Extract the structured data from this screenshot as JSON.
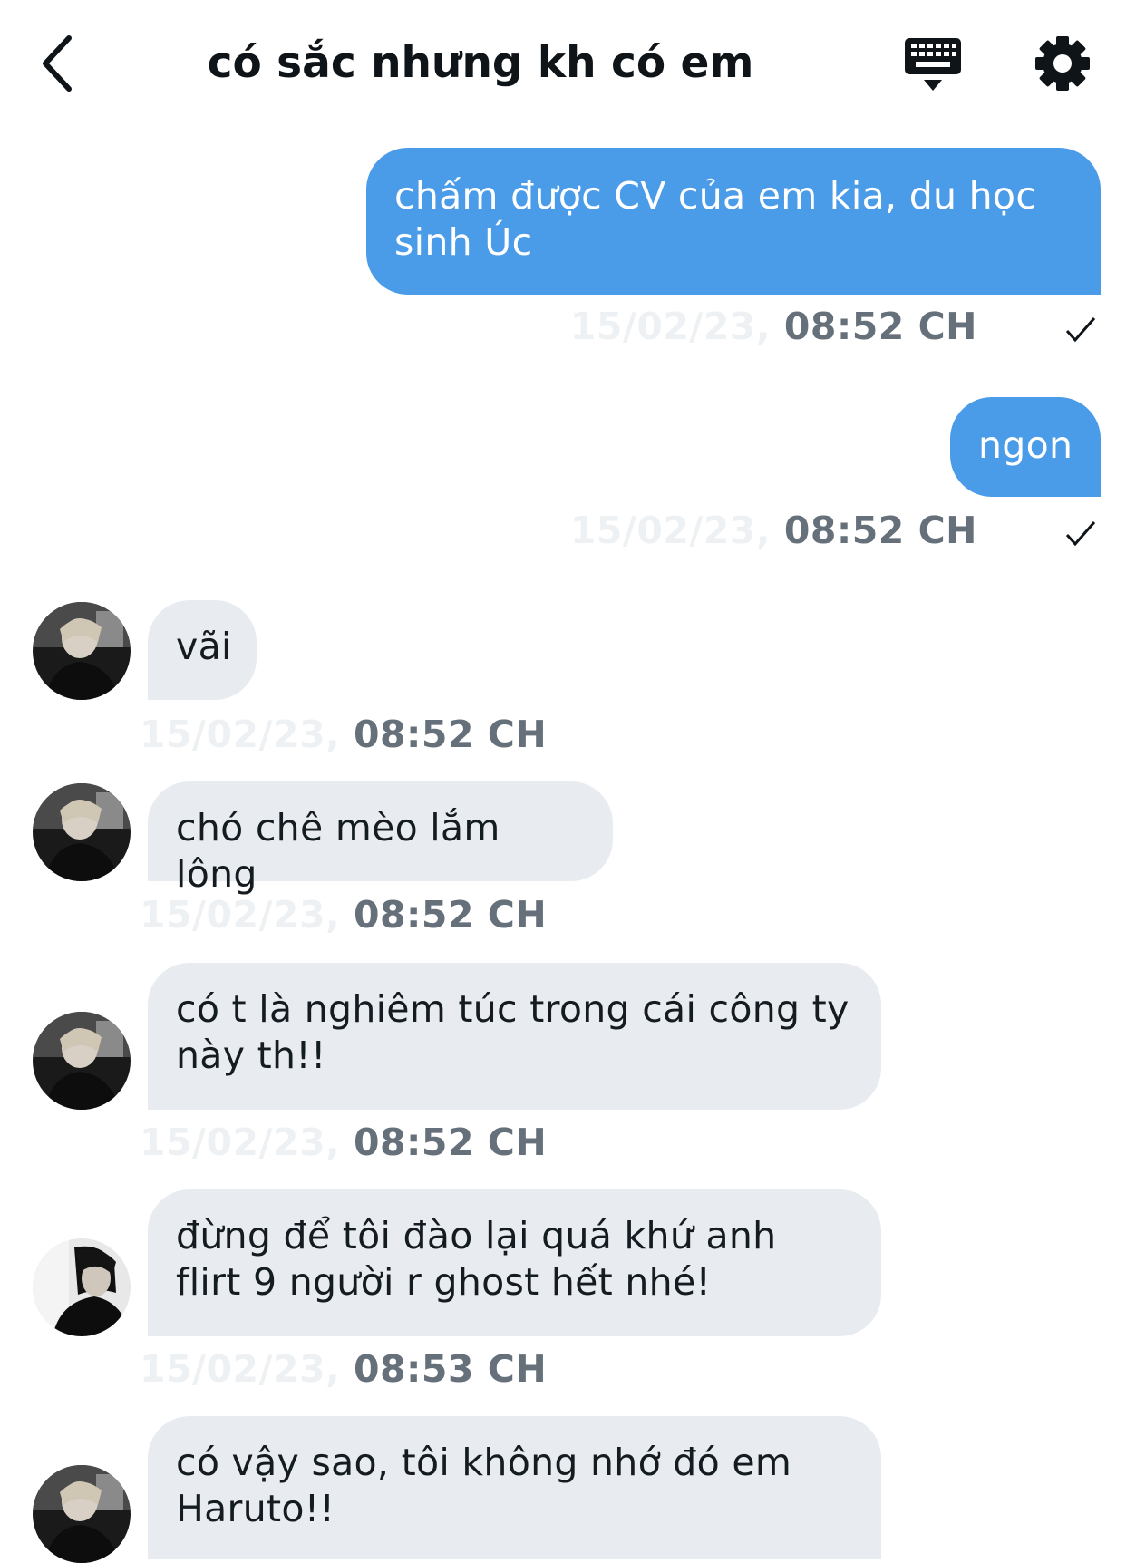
{
  "header": {
    "title": "có sắc nhưng kh có em",
    "back_icon": "chevron-left-icon",
    "keyboard_icon": "keyboard-icon",
    "settings_icon": "gear-icon"
  },
  "colors": {
    "outgoing_bubble": "#4a9be8",
    "incoming_bubble": "#e8ecf0",
    "timestamp": "#66707a"
  },
  "messages": [
    {
      "direction": "outgoing",
      "text": "chấm được CV của em kia, du học sinh Úc",
      "date": "15/02/23,",
      "time": "08:52 CH",
      "status_icon": "checkmark-icon"
    },
    {
      "direction": "outgoing",
      "text": "ngon",
      "date": "15/02/23,",
      "time": "08:52 CH",
      "status_icon": "checkmark-icon"
    },
    {
      "direction": "incoming",
      "text": "vãi",
      "date": "15/02/23,",
      "time": "08:52 CH"
    },
    {
      "direction": "incoming",
      "text": "chó chê mèo lắm lông",
      "date": "15/02/23,",
      "time": "08:52 CH"
    },
    {
      "direction": "incoming",
      "text": "có t là nghiêm túc trong cái công ty này th!!",
      "date": "15/02/23,",
      "time": "08:52 CH"
    },
    {
      "direction": "incoming",
      "text": "đừng để tôi đào lại quá khứ anh flirt 9 người r ghost hết nhé!",
      "date": "15/02/23,",
      "time": "08:53 CH"
    },
    {
      "direction": "incoming",
      "text": "có vậy sao, tôi không nhớ đó em Haruto!!"
    }
  ]
}
